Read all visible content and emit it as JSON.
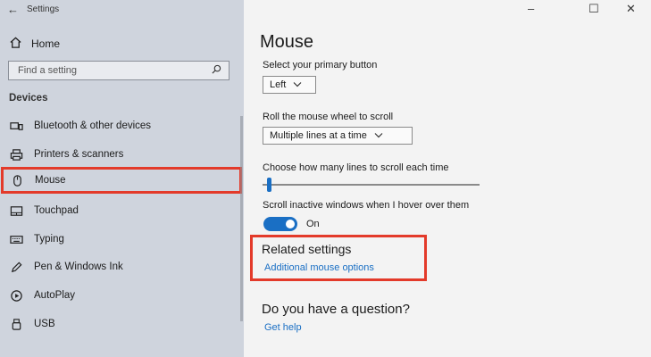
{
  "window": {
    "title": "Settings",
    "back_glyph": "←",
    "minimize_glyph": "–",
    "maximize_glyph": "☐",
    "close_glyph": "✕"
  },
  "sidebar": {
    "home_label": "Home",
    "search_placeholder": "Find a setting",
    "section_label": "Devices",
    "items": [
      {
        "label": "Bluetooth & other devices",
        "icon": "bluetooth-devices-icon"
      },
      {
        "label": "Printers & scanners",
        "icon": "printer-icon"
      },
      {
        "label": "Mouse",
        "icon": "mouse-icon",
        "selected": true
      },
      {
        "label": "Touchpad",
        "icon": "touchpad-icon"
      },
      {
        "label": "Typing",
        "icon": "keyboard-icon"
      },
      {
        "label": "Pen & Windows Ink",
        "icon": "pen-icon"
      },
      {
        "label": "AutoPlay",
        "icon": "autoplay-icon"
      },
      {
        "label": "USB",
        "icon": "usb-icon"
      }
    ]
  },
  "main": {
    "title": "Mouse",
    "primary_button": {
      "label": "Select your primary button",
      "value": "Left"
    },
    "scroll_wheel": {
      "label": "Roll the mouse wheel to scroll",
      "value": "Multiple lines at a time"
    },
    "lines_to_scroll": {
      "label": "Choose how many lines to scroll each time",
      "level": 0.02
    },
    "inactive_scroll": {
      "label": "Scroll inactive windows when I hover over them",
      "state": "On"
    },
    "related": {
      "title": "Related settings",
      "link": "Additional mouse options"
    },
    "question": {
      "title": "Do you have a question?",
      "link": "Get help"
    }
  },
  "colors": {
    "accent": "#1a6fc4",
    "highlight": "#e33a2a"
  }
}
